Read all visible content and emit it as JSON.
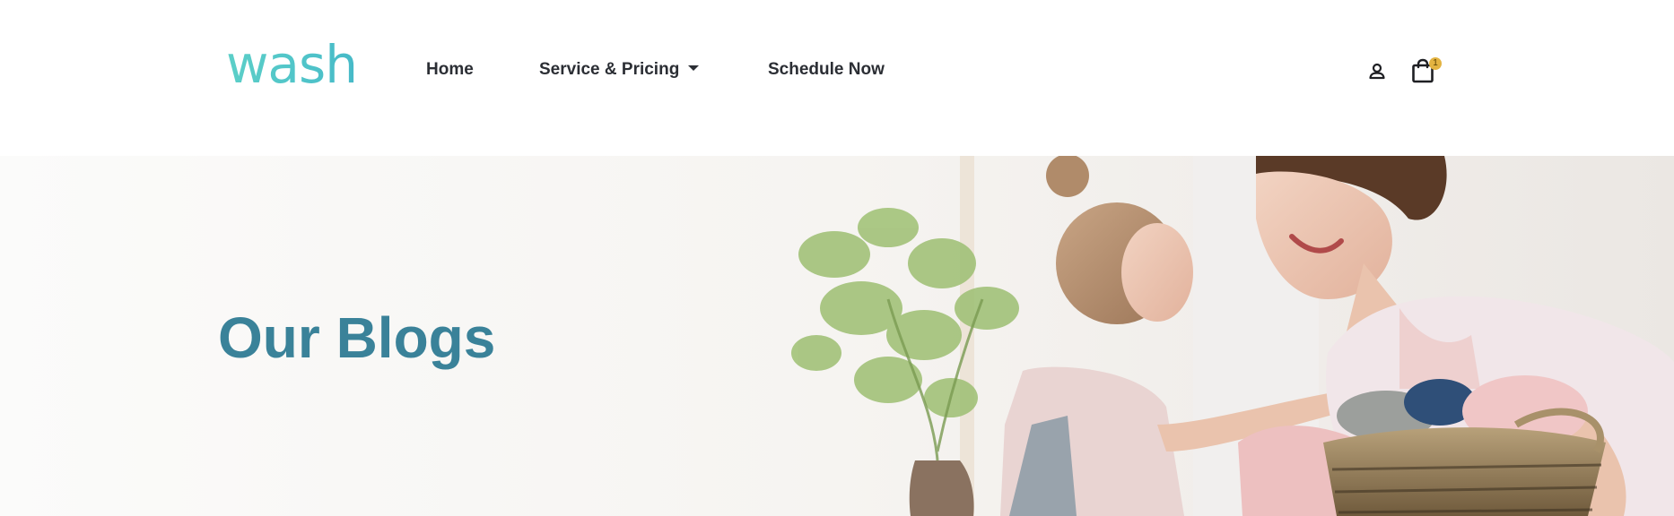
{
  "brand": {
    "logo_text": "wash",
    "logo_color": "#4fc3c9"
  },
  "nav": {
    "items": [
      {
        "label": "Home"
      },
      {
        "label": "Service & Pricing",
        "has_dropdown": true
      },
      {
        "label": "Schedule Now"
      }
    ]
  },
  "header_icons": {
    "account": {
      "icon": "user-icon"
    },
    "cart": {
      "icon": "shopping-bag-icon",
      "count": "1"
    }
  },
  "hero": {
    "title": "Our Blogs",
    "title_color": "#3a8299",
    "image_description_icon": "mother-and-daughter-laundry-photo"
  }
}
